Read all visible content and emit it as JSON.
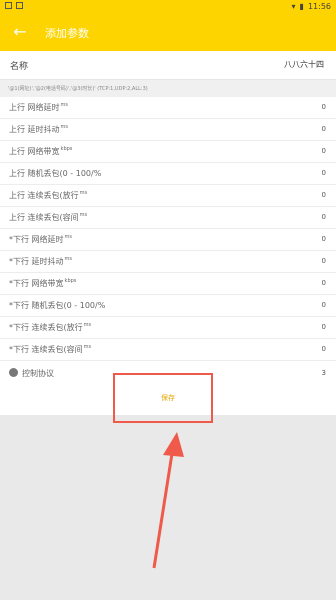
{
  "status_bar": {
    "time": "11:56"
  },
  "toolbar": {
    "back_icon": "back-arrow-icon",
    "title": "添加参数"
  },
  "name_row": {
    "label": "名称",
    "value": "八八六十四"
  },
  "hint": "'@1(网址)','@2(电话号码)','@3(时长)' (TCP:1,UDP:2,ALL:3)",
  "params": [
    {
      "label": "上行 网络延时",
      "unit": "ms",
      "value": "0"
    },
    {
      "label": "上行 延时抖动",
      "unit": "ms",
      "value": "0"
    },
    {
      "label": "上行 网络带宽",
      "unit": "kbps",
      "value": "0"
    },
    {
      "label": "上行 随机丢包(0 - 100/%",
      "unit": "",
      "value": "0"
    },
    {
      "label": "上行 连续丢包(放行",
      "unit": "ms",
      "value": "0"
    },
    {
      "label": "上行 连续丢包(容间",
      "unit": "ms",
      "value": "0"
    },
    {
      "label": "*下行 网络延时",
      "unit": "ms",
      "value": "0"
    },
    {
      "label": "*下行 延时抖动",
      "unit": "ms",
      "value": "0"
    },
    {
      "label": "*下行 网络带宽",
      "unit": "kbps",
      "value": "0"
    },
    {
      "label": "*下行 随机丢包(0 - 100/%",
      "unit": "",
      "value": "0"
    },
    {
      "label": "*下行 连续丢包(放行",
      "unit": "ms",
      "value": "0"
    },
    {
      "label": "*下行 连续丢包(容间",
      "unit": "ms",
      "value": "0"
    }
  ],
  "protocol": {
    "icon": "protocol-icon",
    "label": "控制协议",
    "value": "3"
  },
  "save_button": {
    "label": "保存"
  },
  "colors": {
    "brand": "#fdd400",
    "annotation": "#ef5a4a",
    "save_text": "#e3a300"
  }
}
